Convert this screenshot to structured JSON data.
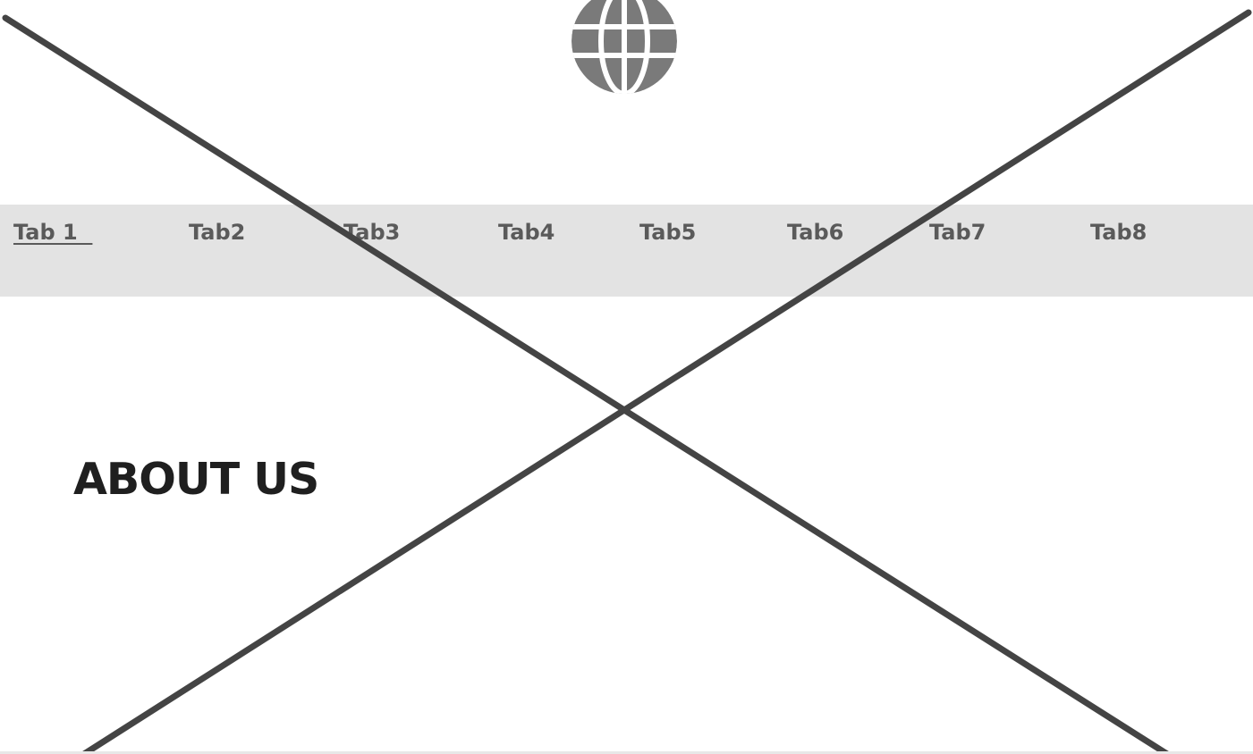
{
  "header": {
    "logo_icon": "globe-icon"
  },
  "nav": {
    "tabs": [
      {
        "label": "Tab 1  ",
        "active": true
      },
      {
        "label": "Tab2",
        "active": false
      },
      {
        "label": "Tab3",
        "active": false
      },
      {
        "label": "Tab4",
        "active": false
      },
      {
        "label": "Tab5",
        "active": false
      },
      {
        "label": "Tab6",
        "active": false
      },
      {
        "label": "Tab7",
        "active": false
      },
      {
        "label": "Tab8",
        "active": false
      }
    ]
  },
  "main": {
    "heading": "ABOUT US"
  },
  "colors": {
    "tabbar_bg": "#e3e3e3",
    "tab_text": "#5a5a5a",
    "heading_text": "#1f1f1f",
    "placeholder_lines": "#444444",
    "logo_fill": "#7a7a7a"
  }
}
